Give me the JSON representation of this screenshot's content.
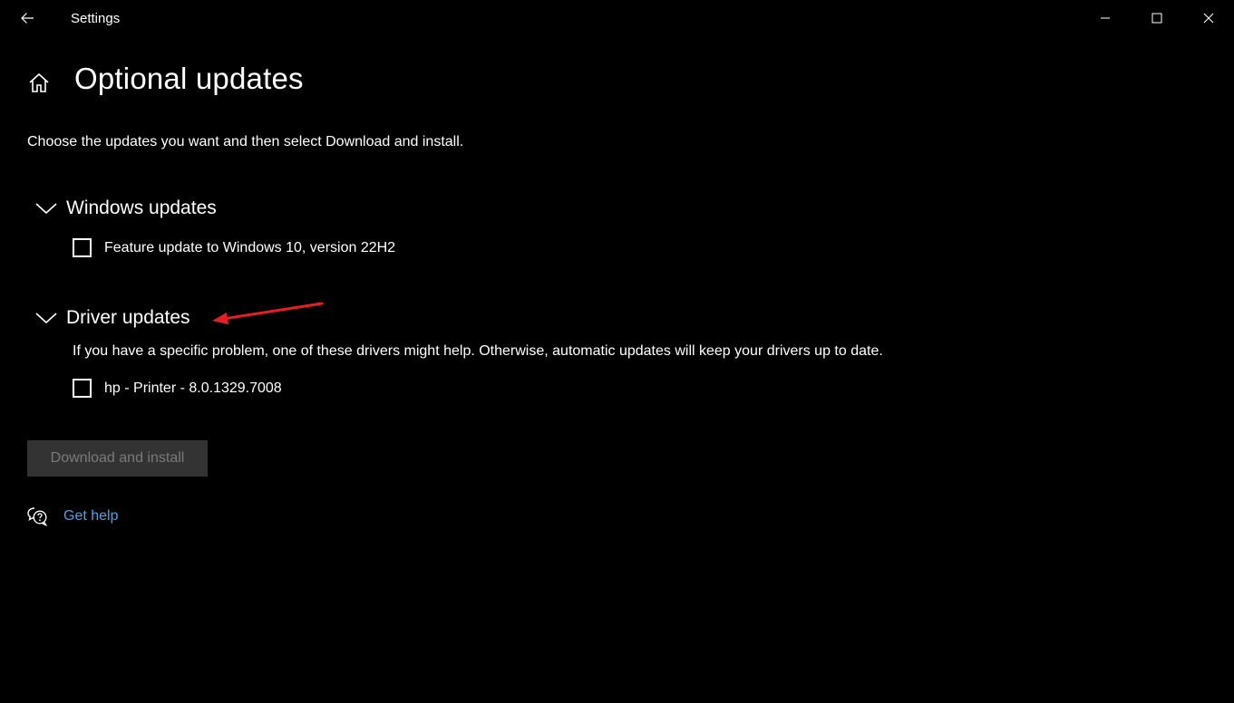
{
  "window": {
    "title": "Settings",
    "back_icon": "back-arrow-icon",
    "controls": [
      "minimize-icon",
      "maximize-icon",
      "close-icon"
    ]
  },
  "page": {
    "home_icon": "home-icon",
    "title": "Optional updates",
    "intro": "Choose the updates you want and then select Download and install."
  },
  "sections": {
    "windows": {
      "title": "Windows updates",
      "items": [
        {
          "label": "Feature update to Windows 10, version 22H2",
          "checked": false
        }
      ]
    },
    "driver": {
      "title": "Driver updates",
      "description": "If you have a specific problem, one of these drivers might help. Otherwise, automatic updates will keep your drivers up to date.",
      "items": [
        {
          "label": "hp - Printer - 8.0.1329.7008",
          "checked": false
        }
      ]
    }
  },
  "actions": {
    "download_label": "Download and install",
    "download_enabled": false
  },
  "help": {
    "icon": "chat-help-icon",
    "label": "Get help"
  },
  "colors": {
    "background": "#000000",
    "text": "#ffffff",
    "link": "#4aa0e8",
    "button_disabled_bg": "#333333",
    "button_disabled_text": "#7a7a7a",
    "annotation": "#e81e25"
  }
}
